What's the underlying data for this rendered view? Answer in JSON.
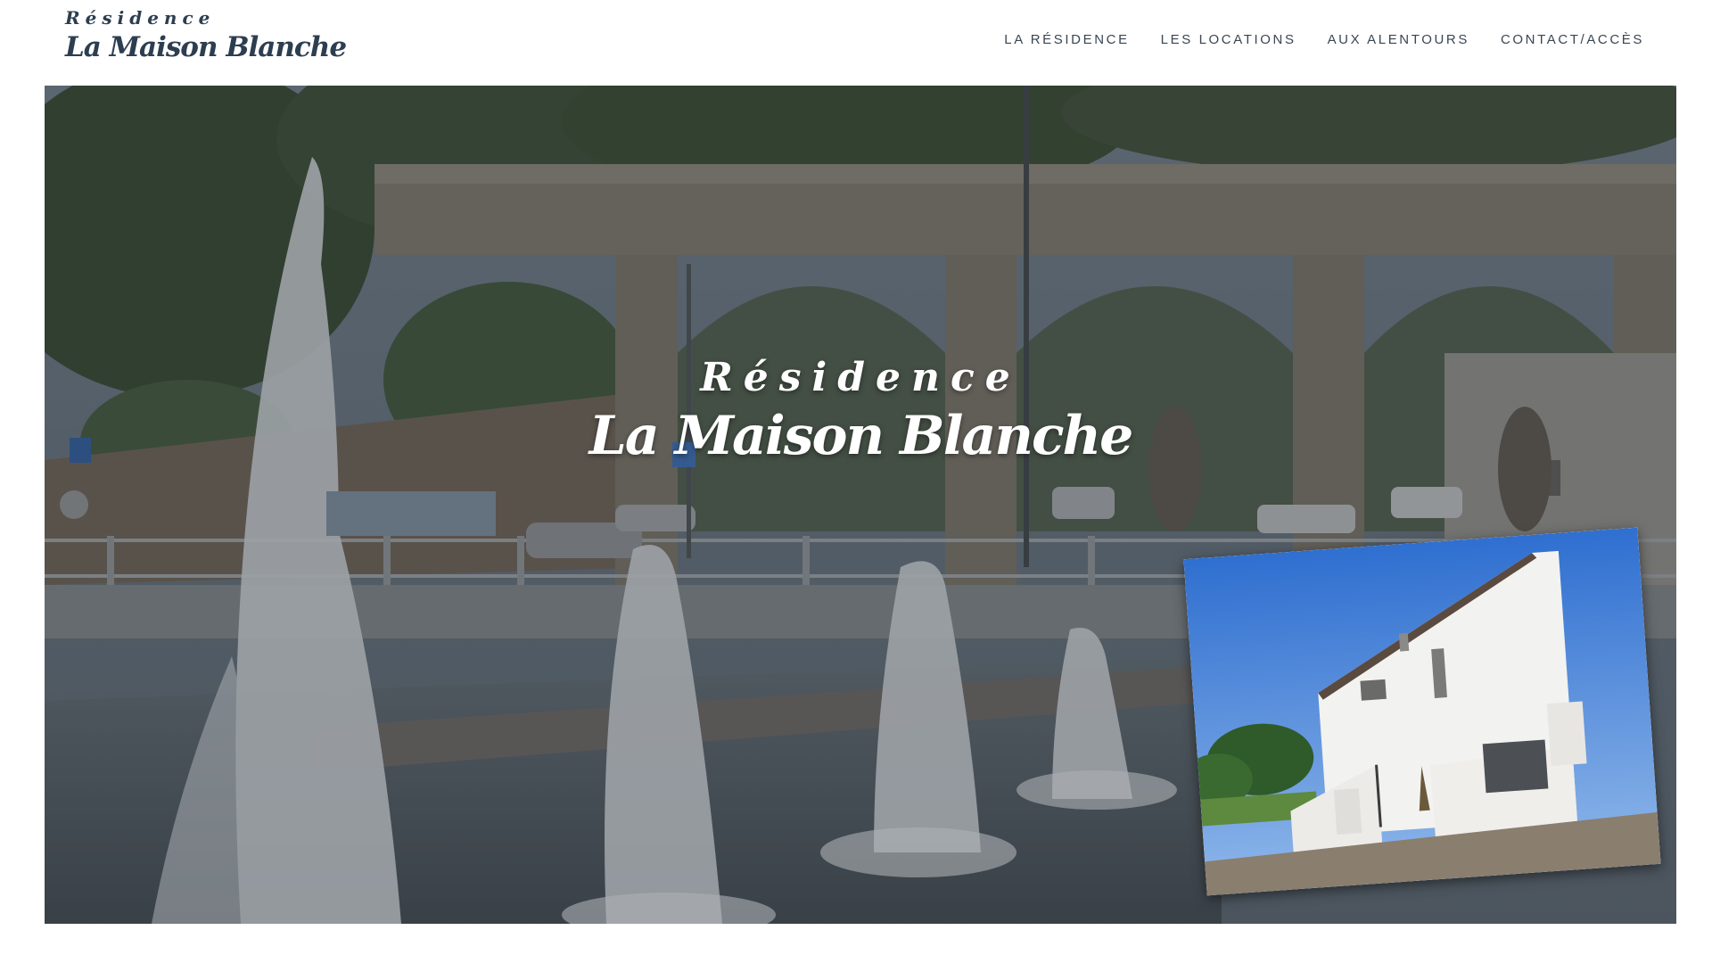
{
  "site": {
    "logo_small": "Résidence",
    "logo_big": "La Maison Blanche"
  },
  "nav": {
    "items": [
      "LA RÉSIDENCE",
      "LES LOCATIONS",
      "AUX ALENTOURS",
      "CONTACT/ACCÈS"
    ]
  },
  "hero": {
    "title_small": "Résidence",
    "title_big": "La Maison Blanche"
  },
  "colors": {
    "brand_text": "#2c3e50",
    "nav_text": "#3a4652",
    "hero_overlay": "#3d4650"
  }
}
